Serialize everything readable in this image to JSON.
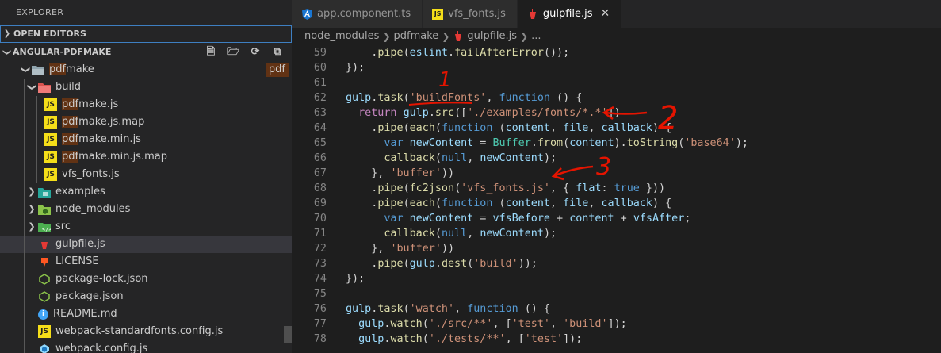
{
  "sidebar": {
    "title": "EXPLORER",
    "open_editors": "OPEN EDITORS",
    "project": "ANGULAR-PDFMAKE",
    "actions": [
      "new-file-icon",
      "new-folder-icon",
      "refresh-icon",
      "collapse-all-icon"
    ],
    "tree": [
      {
        "label_hl": "pdf",
        "label": "make",
        "badge": "pdf"
      },
      {
        "label": "build"
      },
      {
        "label_hl": "pdf",
        "label": "make.js"
      },
      {
        "label_hl": "pdf",
        "label": "make.js.map"
      },
      {
        "label_hl": "pdf",
        "label": "make.min.js"
      },
      {
        "label_hl": "pdf",
        "label": "make.min.js.map"
      },
      {
        "label": "vfs_fonts.js"
      },
      {
        "label": "examples"
      },
      {
        "label": "node_modules"
      },
      {
        "label": "src"
      },
      {
        "label": "gulpfile.js"
      },
      {
        "label": "LICENSE"
      },
      {
        "label": "package-lock.json"
      },
      {
        "label": "package.json"
      },
      {
        "label": "README.md"
      },
      {
        "label_pre": "webpack-standard",
        "label_hl": "",
        "label": "fonts.config.js"
      },
      {
        "label": "webpack.config.js"
      }
    ]
  },
  "tabs": [
    {
      "label": "app.component.ts",
      "icon": "angular-icon"
    },
    {
      "label": "vfs_fonts.js",
      "icon": "js-icon"
    },
    {
      "label": "gulpfile.js",
      "icon": "gulp-icon",
      "active": true
    }
  ],
  "breadcrumb": [
    "node_modules",
    "pdfmake",
    "gulpfile.js",
    "..."
  ],
  "code": {
    "line_numbers": [
      "59",
      "60",
      "61",
      "62",
      "63",
      "64",
      "65",
      "66",
      "67",
      "68",
      "69",
      "70",
      "71",
      "72",
      "73",
      "74",
      "75",
      "76",
      "77",
      "78"
    ]
  },
  "annotations": [
    "1",
    "2",
    "3"
  ],
  "colors": {
    "accent_border": "#3e7fc1",
    "highlight": "#613214",
    "annotation": "#e51400"
  }
}
